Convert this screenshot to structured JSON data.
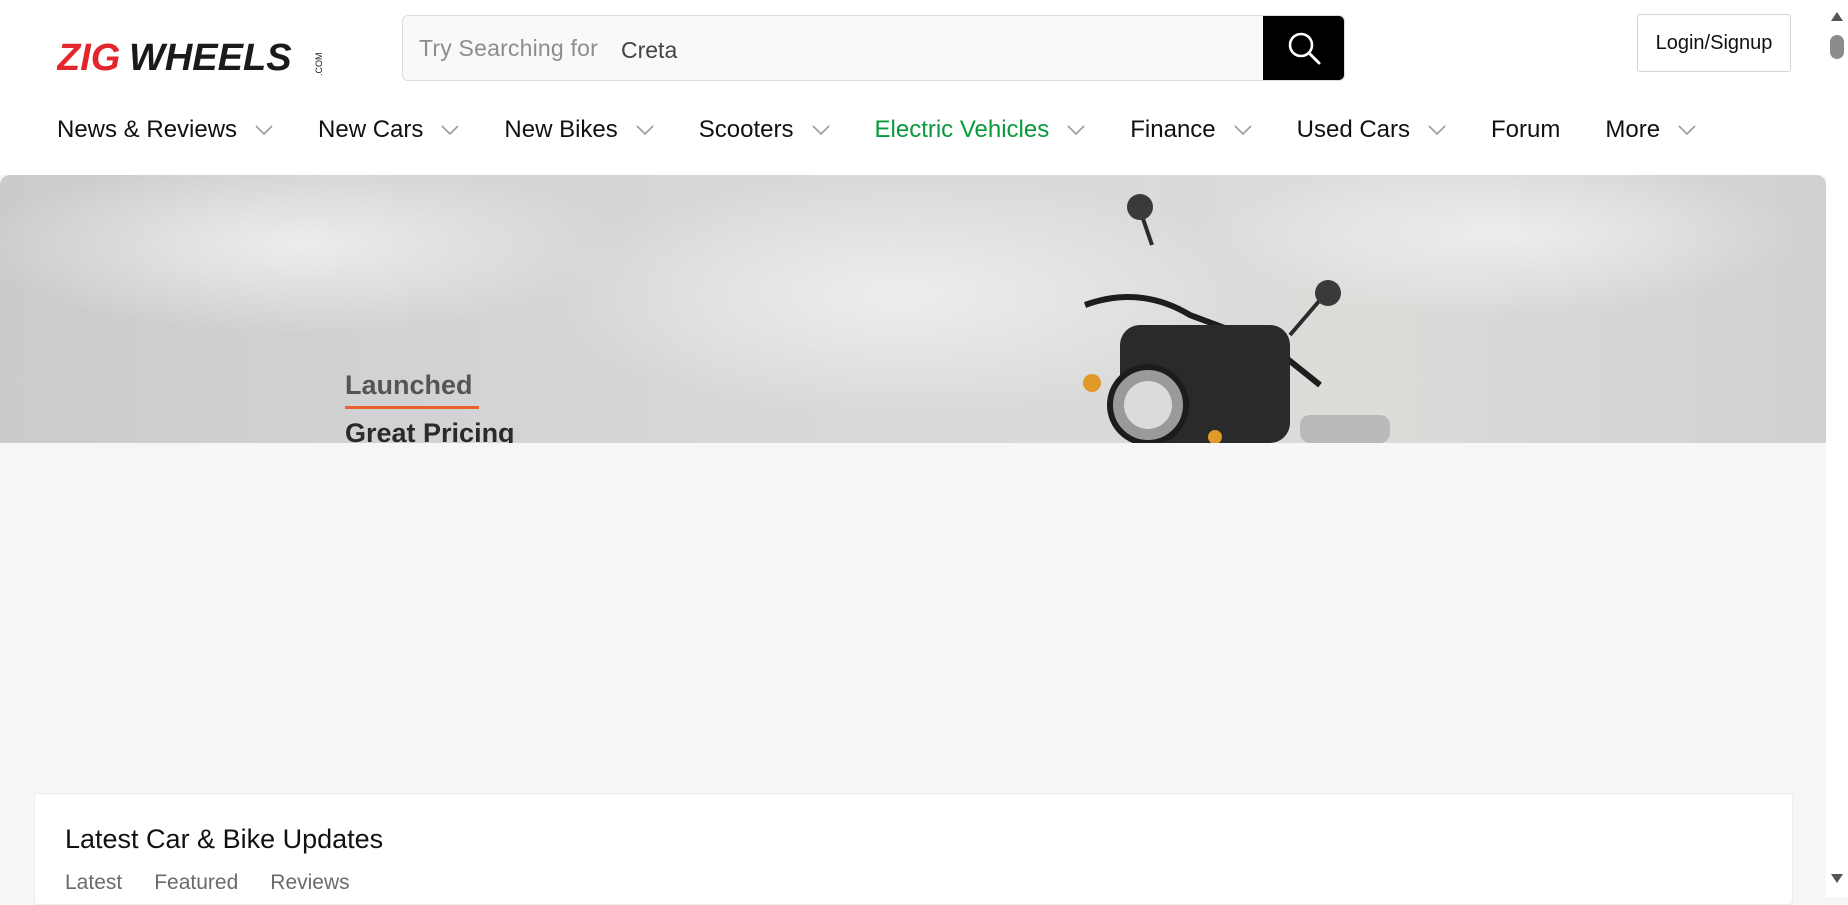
{
  "header": {
    "logo_text": "ZIGWHEELS",
    "logo_suffix": ".COM",
    "search": {
      "placeholder": "Try Searching for",
      "value": "Creta"
    },
    "login_label": "Login/Signup"
  },
  "nav": {
    "items": [
      {
        "label": "News & Reviews",
        "dropdown": true
      },
      {
        "label": "New Cars",
        "dropdown": true
      },
      {
        "label": "New Bikes",
        "dropdown": true
      },
      {
        "label": "Scooters",
        "dropdown": true
      },
      {
        "label": "Electric Vehicles",
        "dropdown": true
      },
      {
        "label": "Finance",
        "dropdown": true
      },
      {
        "label": "Used Cars",
        "dropdown": true
      },
      {
        "label": "Forum",
        "dropdown": false
      },
      {
        "label": "More",
        "dropdown": true
      }
    ]
  },
  "hero": {
    "line1": "Launched",
    "line2": "Great Pricing"
  },
  "updates": {
    "title": "Latest Car & Bike Updates",
    "tabs": [
      "Latest",
      "Featured",
      "Reviews"
    ]
  },
  "colors": {
    "brand_red": "#e3262b",
    "ev_green": "#0a9a3c",
    "accent_orange": "#e8612e"
  }
}
